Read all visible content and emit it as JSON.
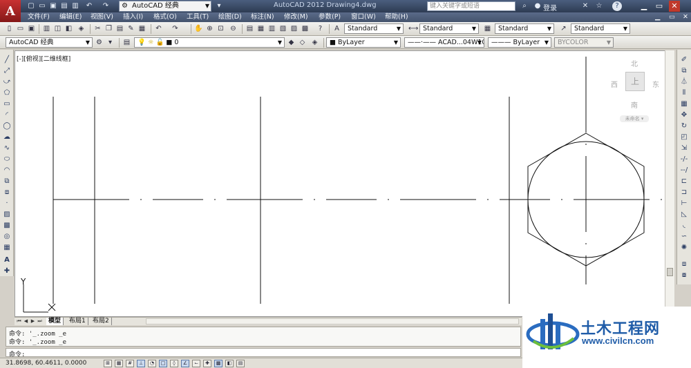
{
  "titlebar": {
    "workspace": "AutoCAD 经典",
    "app_title": "AutoCAD 2012    Drawing4.dwg",
    "search_placeholder": "键入关键字或短语",
    "login": "登录"
  },
  "menu": [
    "文件(F)",
    "编辑(E)",
    "视图(V)",
    "插入(I)",
    "格式(O)",
    "工具(T)",
    "绘图(D)",
    "标注(N)",
    "修改(M)",
    "参数(P)",
    "窗口(W)",
    "帮助(H)"
  ],
  "styles": {
    "text_style": "Standard",
    "dim_style": "Standard",
    "table_style": "Standard",
    "multileader_style": "Standard"
  },
  "layers": {
    "workspace": "AutoCAD 经典",
    "current_layer": "0",
    "color": "ByLayer",
    "linetype": "ACAD...04W100",
    "lineweight": "ByLayer",
    "plotstyle": "BYCOLOR"
  },
  "viewport": {
    "label": "[-][俯视][二维线框]"
  },
  "viewcube": {
    "north": "北",
    "south": "南",
    "east": "东",
    "west": "西",
    "top_face": "上",
    "wcs": "未命名 ▾"
  },
  "ucs": {
    "y": "Y"
  },
  "tabs": [
    "模型",
    "布局1",
    "布局2"
  ],
  "command": {
    "history": [
      "命令: '_.zoom _e",
      "命令: '_.zoom _e"
    ],
    "prompt": "命令:"
  },
  "status": {
    "coords": "31.8698,  60.4611,  0.0000"
  },
  "watermark": {
    "name": "土木工程网",
    "url": "www.civilcn.com"
  }
}
